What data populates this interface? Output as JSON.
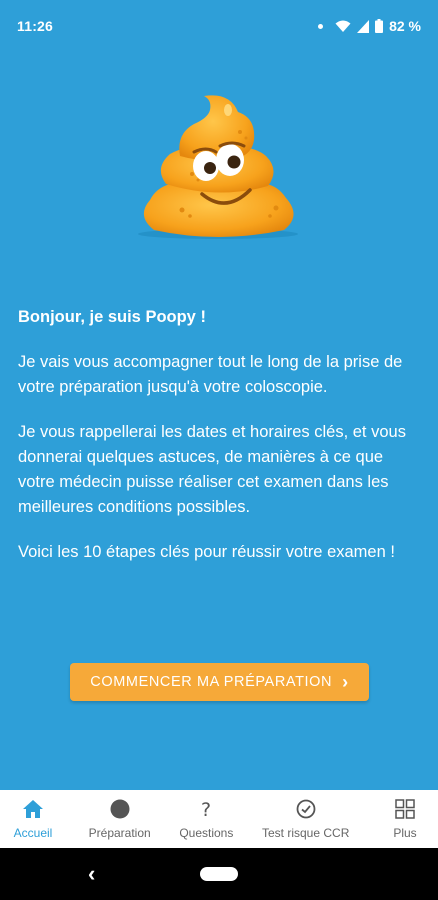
{
  "status_bar": {
    "time": "11:26",
    "battery": "82 %"
  },
  "colors": {
    "background": "#2e9fd8",
    "cta": "#f6a939",
    "active_tab": "#2e9fd8"
  },
  "mascot": {
    "icon": "poop-mascot-icon"
  },
  "content": {
    "greeting": "Bonjour, je suis Poopy !",
    "paragraph1": "Je vais vous accompagner tout le long de la prise de votre préparation jusqu'à votre coloscopie.",
    "paragraph2": "Je vous rappellerai les dates et horaires clés, et vous donnerai quelques astuces, de manières à ce que votre médecin puisse réaliser cet examen dans les meilleures conditions possibles.",
    "paragraph3": "Voici les 10 étapes clés pour réussir votre examen !"
  },
  "cta": {
    "label": "COMMENCER MA PRÉPARATION"
  },
  "tabs": [
    {
      "label": "Accueil",
      "icon": "home-icon",
      "active": true
    },
    {
      "label": "Préparation",
      "icon": "circle-icon",
      "active": false
    },
    {
      "label": "Questions",
      "icon": "question-icon",
      "active": false
    },
    {
      "label": "Test risque CCR",
      "icon": "check-circle-icon",
      "active": false
    },
    {
      "label": "Plus",
      "icon": "grid-icon",
      "active": false
    }
  ]
}
